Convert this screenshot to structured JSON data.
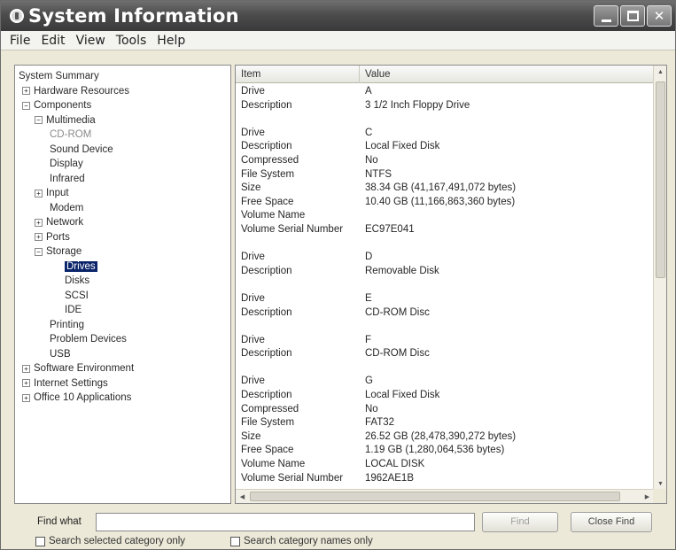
{
  "window": {
    "title": "System Information",
    "controls": {
      "minimize": "minimize",
      "maximize": "maximize",
      "close": "✕"
    }
  },
  "menubar": [
    "File",
    "Edit",
    "View",
    "Tools",
    "Help"
  ],
  "tree": [
    {
      "label": "System Summary",
      "level": 0,
      "expander": "",
      "state": "normal"
    },
    {
      "label": "Hardware Resources",
      "level": 1,
      "expander": "+",
      "state": "normal"
    },
    {
      "label": "Components",
      "level": 1,
      "expander": "−",
      "state": "normal"
    },
    {
      "label": "Multimedia",
      "level": 2,
      "expander": "−",
      "state": "normal"
    },
    {
      "label": "CD-ROM",
      "level": 3,
      "expander": "",
      "state": "grey"
    },
    {
      "label": "Sound Device",
      "level": 3,
      "expander": "",
      "state": "normal"
    },
    {
      "label": "Display",
      "level": 3,
      "expander": "",
      "state": "normal"
    },
    {
      "label": "Infrared",
      "level": 3,
      "expander": "",
      "state": "normal"
    },
    {
      "label": "Input",
      "level": 2,
      "expander": "+",
      "state": "normal"
    },
    {
      "label": "Modem",
      "level": 3,
      "expander": "",
      "state": "normal"
    },
    {
      "label": "Network",
      "level": 2,
      "expander": "+",
      "state": "normal"
    },
    {
      "label": "Ports",
      "level": 2,
      "expander": "+",
      "state": "normal"
    },
    {
      "label": "Storage",
      "level": 2,
      "expander": "−",
      "state": "normal"
    },
    {
      "label": "Drives",
      "level": 4,
      "expander": "",
      "state": "selected"
    },
    {
      "label": "Disks",
      "level": 4,
      "expander": "",
      "state": "normal"
    },
    {
      "label": "SCSI",
      "level": 4,
      "expander": "",
      "state": "normal"
    },
    {
      "label": "IDE",
      "level": 4,
      "expander": "",
      "state": "normal"
    },
    {
      "label": "Printing",
      "level": 3,
      "expander": "",
      "state": "normal"
    },
    {
      "label": "Problem Devices",
      "level": 3,
      "expander": "",
      "state": "normal"
    },
    {
      "label": "USB",
      "level": 3,
      "expander": "",
      "state": "normal"
    },
    {
      "label": "Software Environment",
      "level": 1,
      "expander": "+",
      "state": "normal"
    },
    {
      "label": "Internet Settings",
      "level": 1,
      "expander": "+",
      "state": "normal"
    },
    {
      "label": "Office 10 Applications",
      "level": 1,
      "expander": "+",
      "state": "normal"
    }
  ],
  "list": {
    "headers": {
      "item": "Item",
      "value": "Value"
    },
    "rows": [
      {
        "item": "Drive",
        "value": "A"
      },
      {
        "item": "Description",
        "value": "3 1/2 Inch Floppy Drive"
      },
      {
        "item": "",
        "value": ""
      },
      {
        "item": "Drive",
        "value": "C"
      },
      {
        "item": "Description",
        "value": "Local Fixed Disk"
      },
      {
        "item": "Compressed",
        "value": "No"
      },
      {
        "item": "File System",
        "value": "NTFS"
      },
      {
        "item": "Size",
        "value": "38.34 GB (41,167,491,072 bytes)"
      },
      {
        "item": "Free Space",
        "value": "10.40 GB (11,166,863,360 bytes)"
      },
      {
        "item": "Volume Name",
        "value": ""
      },
      {
        "item": "Volume Serial Number",
        "value": "EC97E041"
      },
      {
        "item": "",
        "value": ""
      },
      {
        "item": "Drive",
        "value": "D"
      },
      {
        "item": "Description",
        "value": "Removable Disk"
      },
      {
        "item": "",
        "value": ""
      },
      {
        "item": "Drive",
        "value": "E"
      },
      {
        "item": "Description",
        "value": "CD-ROM Disc"
      },
      {
        "item": "",
        "value": ""
      },
      {
        "item": "Drive",
        "value": "F"
      },
      {
        "item": "Description",
        "value": "CD-ROM Disc"
      },
      {
        "item": "",
        "value": ""
      },
      {
        "item": "Drive",
        "value": "G"
      },
      {
        "item": "Description",
        "value": "Local Fixed Disk"
      },
      {
        "item": "Compressed",
        "value": "No"
      },
      {
        "item": "File System",
        "value": "FAT32"
      },
      {
        "item": "Size",
        "value": "26.52 GB (28,478,390,272 bytes)"
      },
      {
        "item": "Free Space",
        "value": "1.19 GB (1,280,064,536 bytes)"
      },
      {
        "item": "Volume Name",
        "value": "LOCAL DISK"
      },
      {
        "item": "Volume Serial Number",
        "value": "1962AE1B"
      }
    ]
  },
  "findbar": {
    "label": "Find what",
    "value": "",
    "find_button": "Find",
    "close_find_button": "Close Find",
    "check_selected": "Search selected category only",
    "check_names": "Search category names only"
  },
  "colors": {
    "selection": "#0a246a",
    "titlebar": "#4c4c4c"
  }
}
